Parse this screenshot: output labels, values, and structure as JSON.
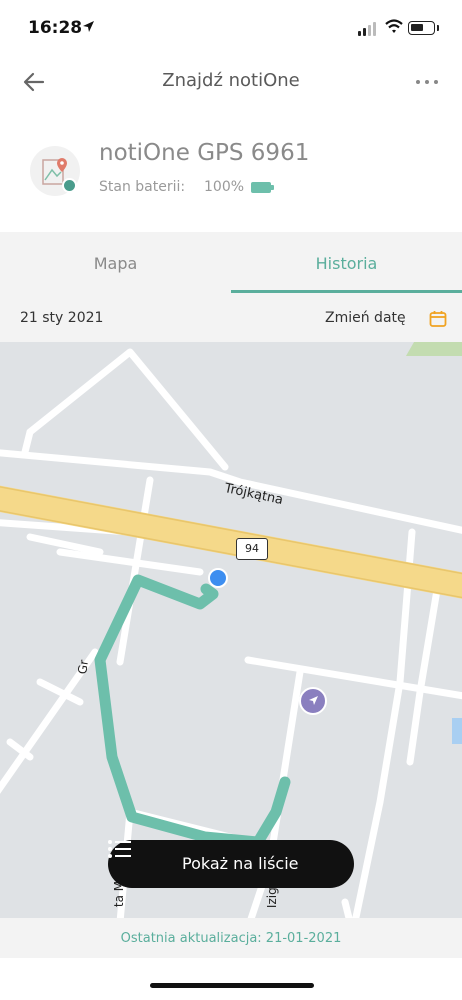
{
  "status_bar": {
    "time": "16:28"
  },
  "header": {
    "title": "Znajdź notiOne"
  },
  "device": {
    "name": "notiOne GPS 6961",
    "battery_label": "Stan baterii:",
    "battery_value": "100%"
  },
  "tabs": [
    {
      "label": "Mapa",
      "active": false
    },
    {
      "label": "Historia",
      "active": true
    }
  ],
  "date_bar": {
    "date": "21 sty 2021",
    "change_date_label": "Zmień datę"
  },
  "map": {
    "labels": {
      "street": "Trójkątna",
      "road_number": "94",
      "street2": "Gr",
      "street3": "ta M",
      "street4": "Iziga"
    },
    "list_button_label": "Pokaż na liście"
  },
  "footer": {
    "last_update": "Ostatnia aktualizacja: 21-01-2021"
  },
  "colors": {
    "accent": "#5aae9c",
    "route": "#6dbfab",
    "road_major": "#f5d98a",
    "map_bg": "#dfe2e5",
    "marker": "#3d8ef0"
  },
  "icons": [
    "location-arrow-icon",
    "signal-icon",
    "wifi-icon",
    "battery-icon",
    "back-arrow-icon",
    "more-icon",
    "device-map-icon",
    "calendar-icon",
    "list-icon"
  ]
}
